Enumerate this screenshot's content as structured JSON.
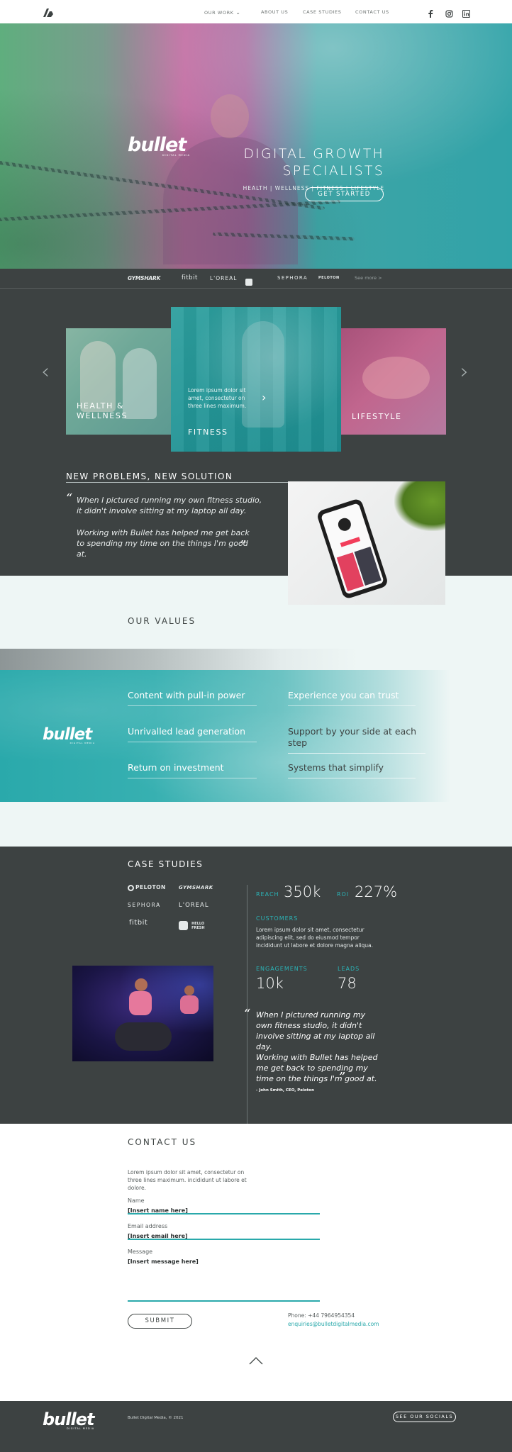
{
  "nav": {
    "items": [
      "OUR WORK",
      "ABOUT US",
      "CASE STUDIES",
      "CONTACT US"
    ],
    "social": [
      "facebook-icon",
      "instagram-icon",
      "linkedin-icon"
    ]
  },
  "hero": {
    "logo": "bullet",
    "logo_sub": "DIGITAL MEDIA",
    "title_line1": "DIGITAL GROWTH",
    "title_line2": "SPECIALISTS",
    "subtitle": "HEALTH | WELLNESS | FITNESS | LIFESTYLE",
    "cta": "GET STARTED"
  },
  "brands": {
    "items": [
      "GYMSHARK",
      "fitbit",
      "L'OREAL",
      "HELLO FRESH",
      "SEPHORA",
      "PELOTON"
    ],
    "more": "See more",
    "more_arrow": ">"
  },
  "carousel": {
    "cards": [
      {
        "label": "HEALTH &",
        "label2": "WELLNESS"
      },
      {
        "label": "FITNESS",
        "text": "Lorem ipsum dolor sit amet, consectetur on three lines maximum."
      },
      {
        "label": "LIFESTYLE"
      }
    ],
    "prev": "‹",
    "next": "›",
    "card_arrow": "›"
  },
  "problems": {
    "title": "NEW PROBLEMS, NEW SOLUTION",
    "quote1": "When I pictured running my own fitness studio, it didn't involve sitting at my laptop all day.",
    "quote2": "Working with Bullet has helped me get back to spending my time on the things I'm good at.",
    "open_quote": "“",
    "close_quote": "”"
  },
  "values": {
    "title": "OUR VALUES",
    "left": [
      "Content with pull-in power",
      "Unrivalled lead generation",
      "Return on investment"
    ],
    "right": [
      "Experience you can trust",
      "Support by your side at each step",
      "Systems that simplify"
    ]
  },
  "case_studies": {
    "title": "CASE STUDIES",
    "logos": [
      "PELOTON",
      "GYMSHARK",
      "SEPHORA",
      "L'OREAL",
      "fitbit",
      "HELLO FRESH"
    ],
    "reach_label": "REACH",
    "reach": "350k",
    "roi_label": "ROI",
    "roi": "227%",
    "customers_label": "CUSTOMERS",
    "customers_text": "Lorem ipsum dolor sit amet, consectetur adipiscing elit, sed do eiusmod tempor incididunt ut labore et dolore magna aliqua.",
    "engagements_label": "ENGAGEMENTS",
    "engagements": "10k",
    "leads_label": "LEADS",
    "leads": "78",
    "quote1": "When I pictured running my own fitness studio, it didn't involve sitting at my laptop all day.",
    "quote2": "Working with Bullet has helped me get back to spending my time on the things I'm good at.",
    "attribution": "- John Smith, CEO, Peloton",
    "open_quote": "“",
    "close_quote": "”"
  },
  "contact": {
    "title": "CONTACT US",
    "intro": "Lorem ipsum dolor sit amet, consectetur on three lines maximum. incididunt ut labore et dolore.",
    "name_label": "Name",
    "name_value": "[Insert name here]",
    "email_label": "Email address",
    "email_value": "[Insert email here]",
    "message_label": "Message",
    "message_value": "[Insert message here]",
    "submit": "SUBMIT",
    "phone": "Phone: +44 7964954354",
    "email": "enquiries@bulletdigitalmedia.com"
  },
  "footer": {
    "logo": "bullet",
    "logo_sub": "DIGITAL MEDIA",
    "copyright": "Bullet Digital Media, © 2021",
    "socials_btn": "SEE OUR SOCIALS"
  },
  "colors": {
    "teal": "#2aa9ab",
    "dark": "#3d4242",
    "mint": "#eef6f5"
  }
}
